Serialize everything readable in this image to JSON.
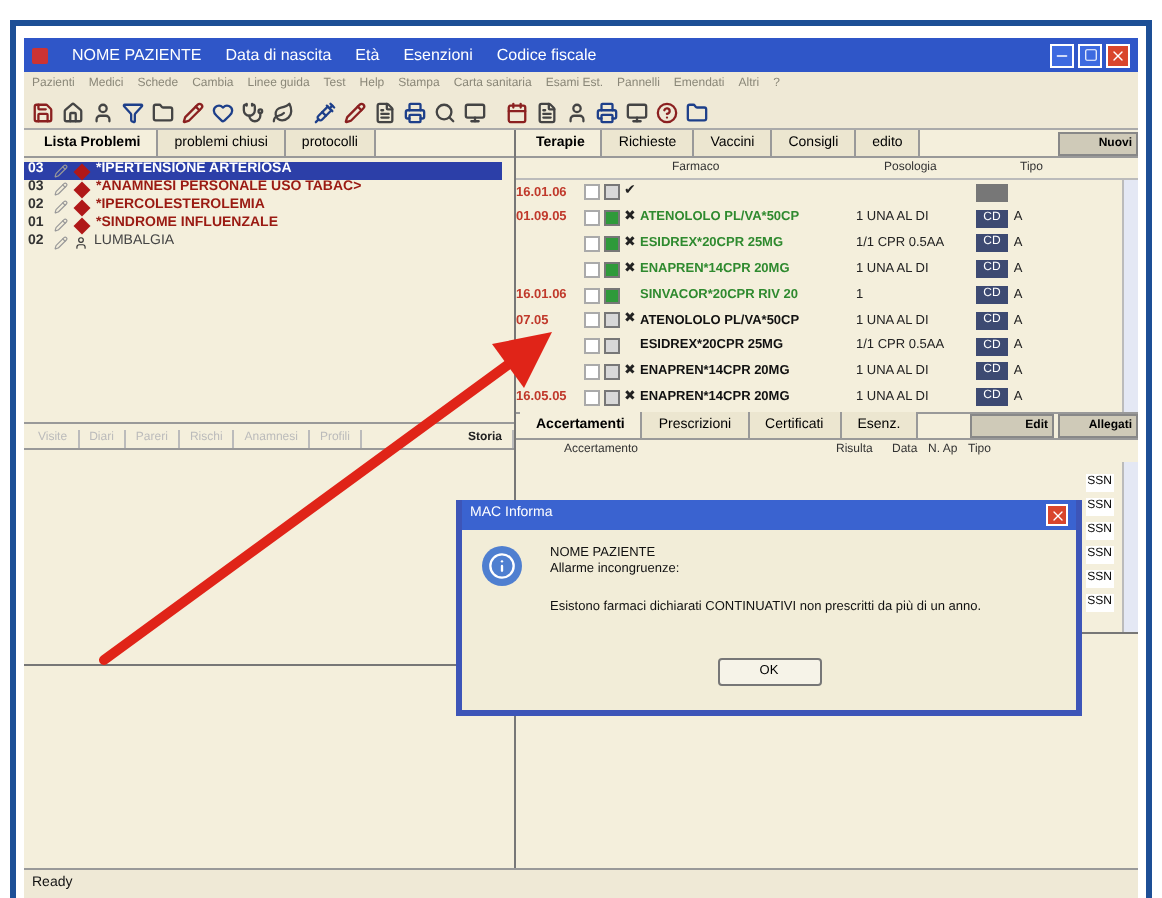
{
  "window": {
    "title_parts": [
      "NOME PAZIENTE",
      "Data di nascita",
      "Età",
      "Esenzioni",
      "Codice fiscale"
    ]
  },
  "menu": [
    "Pazienti",
    "Medici",
    "Schede",
    "Cambia",
    "Linee guida",
    "Test",
    "Help",
    "Stampa",
    "Carta sanitaria",
    "Esami Est.",
    "Pannelli",
    "Emendati",
    "Altri",
    "?"
  ],
  "problems": {
    "tabs": [
      {
        "label": "Lista Problemi",
        "selected": true
      },
      {
        "label": "problemi chiusi",
        "selected": false
      },
      {
        "label": "protocolli",
        "selected": false
      }
    ],
    "rows": [
      {
        "code": "03",
        "text": "*IPERTENSIONE ARTERIOSA",
        "kind": "major",
        "selected": true
      },
      {
        "code": "03",
        "text": "*ANAMNESI PERSONALE USO TABAC>",
        "kind": "major",
        "selected": false
      },
      {
        "code": "02",
        "text": "*IPERCOLESTEROLEMIA",
        "kind": "major",
        "selected": false
      },
      {
        "code": "01",
        "text": "*SINDROME INFLUENZALE",
        "kind": "major",
        "selected": false
      },
      {
        "code": "02",
        "text": "LUMBALGIA",
        "kind": "minor",
        "selected": false
      }
    ]
  },
  "history_tabs": [
    {
      "label": "Visite",
      "disabled": true
    },
    {
      "label": "Diari",
      "disabled": true
    },
    {
      "label": "Pareri",
      "disabled": true
    },
    {
      "label": "Rischi",
      "disabled": true
    },
    {
      "label": "Anamnesi",
      "disabled": true
    },
    {
      "label": "Profili",
      "disabled": true
    },
    {
      "label": "Storia",
      "disabled": false
    }
  ],
  "therapy": {
    "tabs": [
      {
        "label": "Terapie",
        "selected": true
      },
      {
        "label": "Richieste",
        "selected": false
      },
      {
        "label": "Vaccini",
        "selected": false
      },
      {
        "label": "Consigli",
        "selected": false
      },
      {
        "label": "edito",
        "selected": false
      }
    ],
    "button": "Nuovi",
    "columns": [
      "Farmaco",
      "Posologia",
      "Tipo"
    ],
    "rows": [
      {
        "date": "16.01.06",
        "mark": "✔",
        "active": false,
        "checked": false
      },
      {
        "date": "01.09.05",
        "mark": "✖",
        "drug": "ATENOLOLO PL/VA*50CP",
        "dosage": "1 UNA AL DI",
        "type": "CD",
        "class": "A",
        "active": true,
        "checked": false
      },
      {
        "mark": "✖",
        "drug": "ESIDREX*20CPR 25MG",
        "dosage": "1/1 CPR 0.5AA",
        "type": "CD",
        "class": "A",
        "active": true,
        "checked": false
      },
      {
        "mark": "✖",
        "drug": "ENAPREN*14CPR 20MG",
        "dosage": "1 UNA AL DI",
        "type": "CD",
        "class": "A",
        "active": true,
        "checked": false
      },
      {
        "date": "16.01.06",
        "drug": "SINVACOR*20CPR RIV 20",
        "dosage": "1",
        "type": "CD",
        "class": "A",
        "active": true,
        "checked": false
      },
      {
        "date": "07.05",
        "mark": "✖",
        "drug": "ATENOLOLO PL/VA*50CP",
        "dosage": "1 UNA AL DI",
        "type": "CD",
        "class": "A",
        "active": false,
        "checked": false
      },
      {
        "drug": "ESIDREX*20CPR 25MG",
        "dosage": "1/1 CPR 0.5AA",
        "type": "CD",
        "class": "A",
        "active": false,
        "checked": false
      },
      {
        "mark": "✖",
        "drug": "ENAPREN*14CPR 20MG",
        "dosage": "1 UNA AL DI",
        "type": "CD",
        "class": "A",
        "active": false,
        "checked": false
      },
      {
        "date": "16.05.05",
        "mark": "✖",
        "drug": "ENAPREN*14CPR 20MG",
        "dosage": "1 UNA AL DI",
        "type": "CD",
        "class": "A",
        "active": false,
        "checked": false
      }
    ]
  },
  "exams": {
    "tabs": [
      {
        "label": "Accertamenti",
        "selected": true
      },
      {
        "label": "Prescrizioni",
        "selected": false
      },
      {
        "label": "Certificati",
        "selected": false
      },
      {
        "label": "Esenz.",
        "selected": false
      }
    ],
    "buttons": [
      "Edit",
      "Allegati"
    ],
    "columns": [
      "Accertamento",
      "Risulta",
      "Data",
      "N. Ap",
      "Tipo"
    ],
    "rows": [
      {
        "type": "SSN"
      },
      {
        "type": "SSN"
      },
      {
        "type": "SSN"
      },
      {
        "type": "SSN"
      },
      {
        "type": "SSN"
      },
      {
        "type": "SSN"
      }
    ]
  },
  "dialog": {
    "title": "MAC Informa",
    "lines": [
      "NOME PAZIENTE",
      "Allarme incongruenze:"
    ],
    "message": "Esistono farmaci dichiarati CONTINUATIVI non prescritti da più di un anno.",
    "button": "OK"
  },
  "status_bar": "Ready"
}
